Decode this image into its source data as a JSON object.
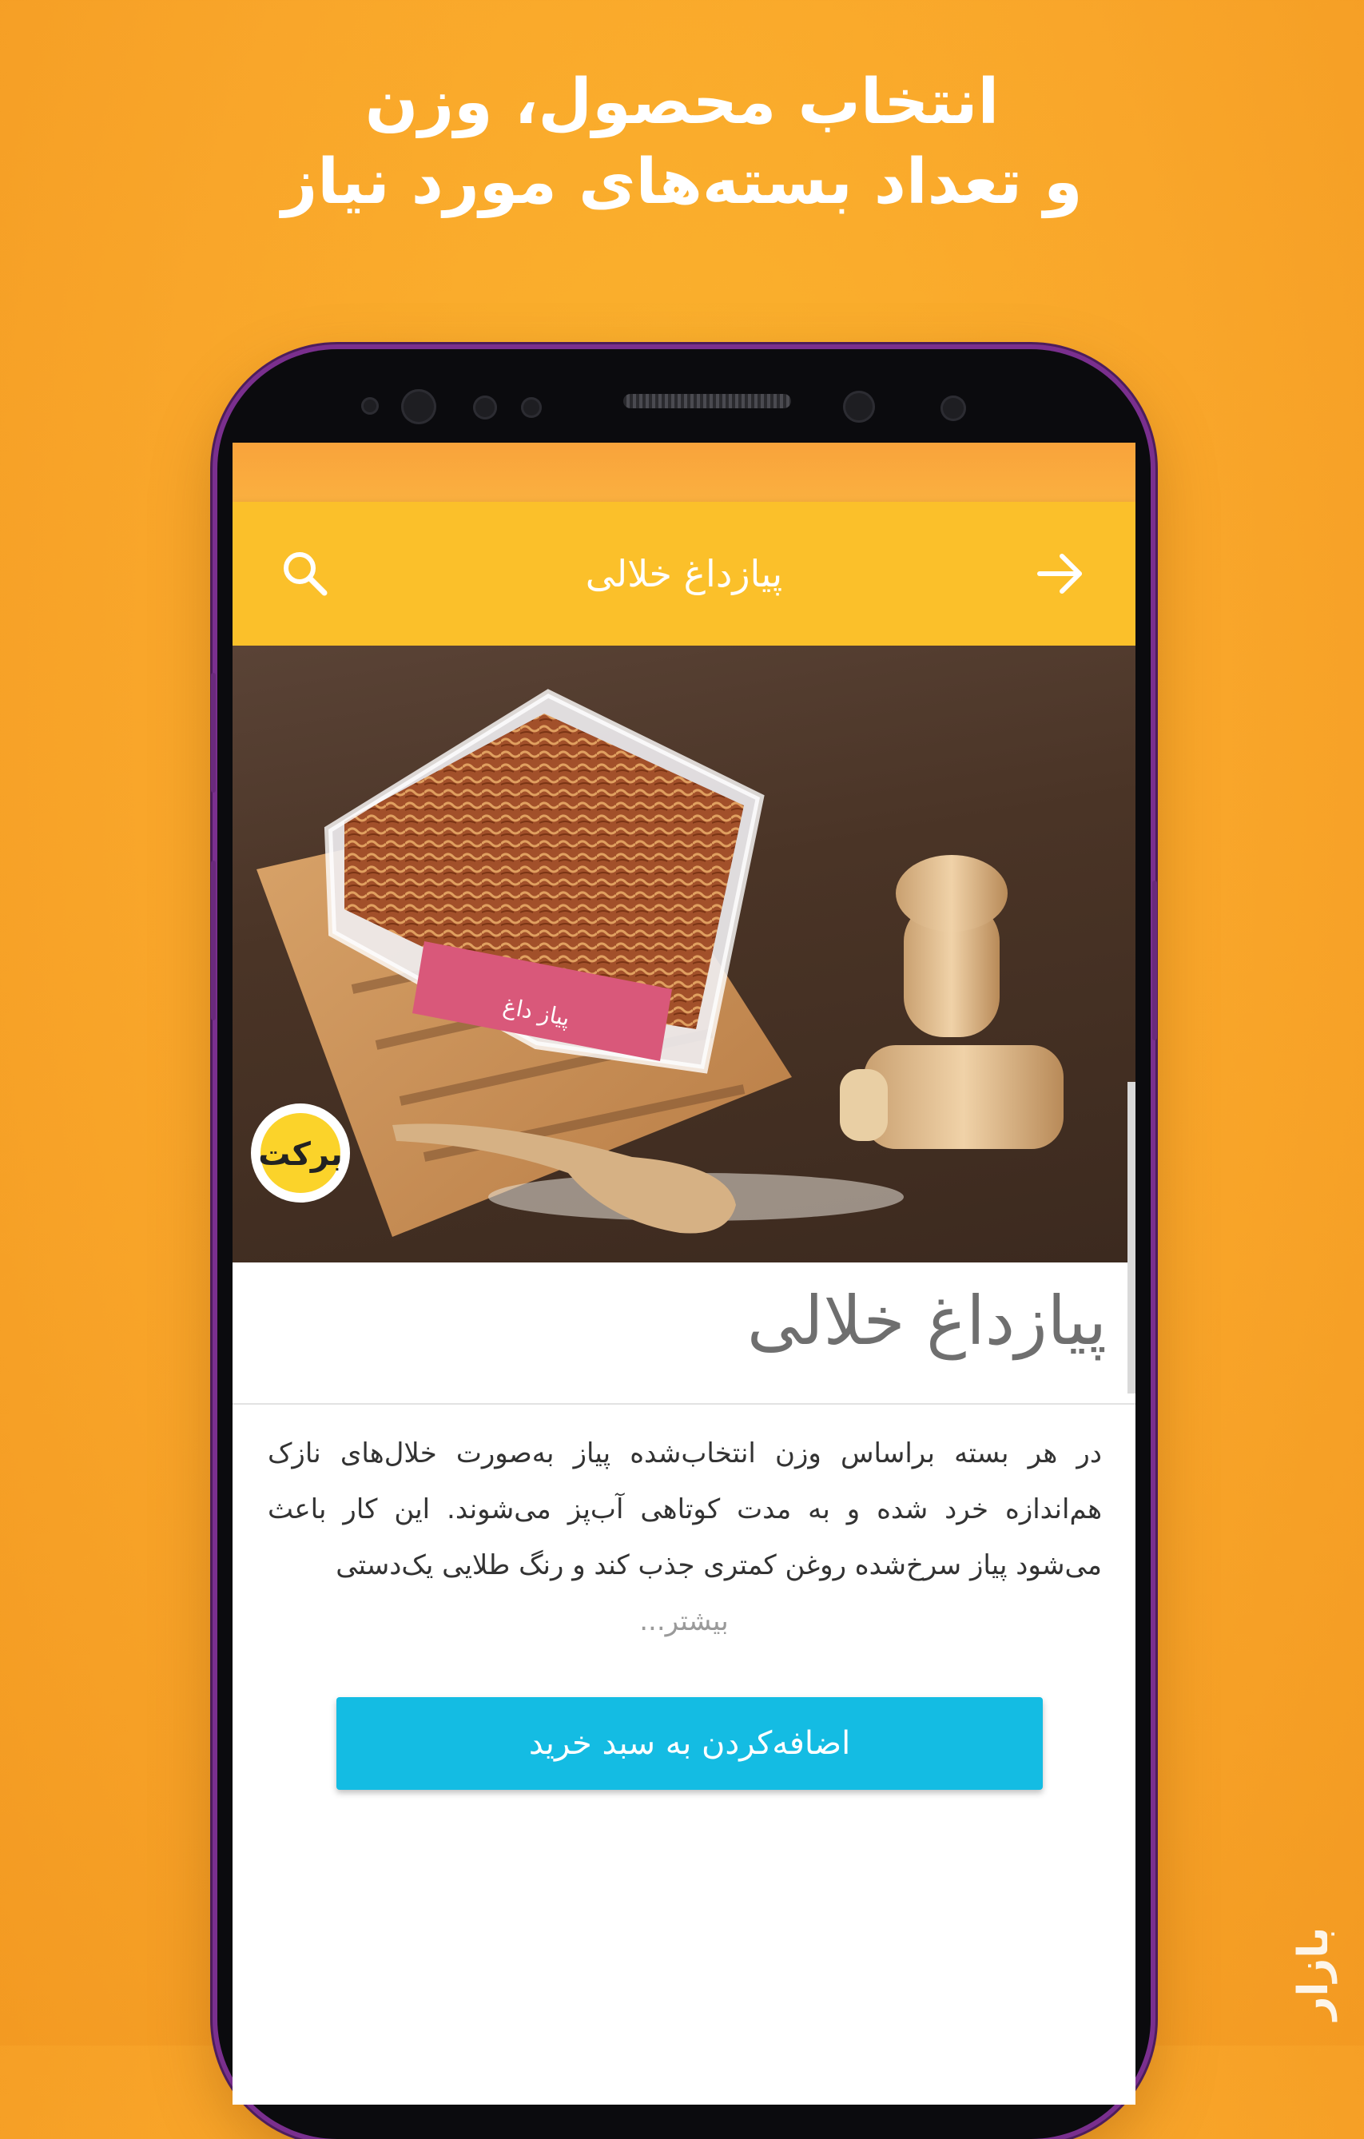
{
  "promo": {
    "line1": "انتخاب محصول، وزن",
    "line2": "و تعداد بسته‌های مورد نیاز"
  },
  "appbar": {
    "title": "پیازداغ خلالی",
    "back_icon": "arrow-right-icon",
    "search_icon": "search-icon"
  },
  "hero": {
    "package_label": "پیاز داغ",
    "brand_logo": "برکت"
  },
  "product": {
    "title": "پیازداغ خلالی",
    "description": "در هر بسته براساس وزن انتخاب‌شده پیاز به‌صورت خلال‌های نازک هم‌اندازه خرد شده و به مدت کوتاهی آب‌پز می‌شوند. این کار باعث می‌شود پیاز سرخ‌شده روغن کمتری جذب کند و رنگ طلایی یک‌دستی",
    "more_link": "بیشتر..."
  },
  "actions": {
    "add_to_cart": "اضافه‌کردن به سبد خرید"
  },
  "watermark": "بازار",
  "colors": {
    "background": "#f9a62a",
    "appbar": "#fbc02a",
    "status_bar": "#f9a33b",
    "button": "#14bce3",
    "phone_frame": "#7a2f8e"
  }
}
